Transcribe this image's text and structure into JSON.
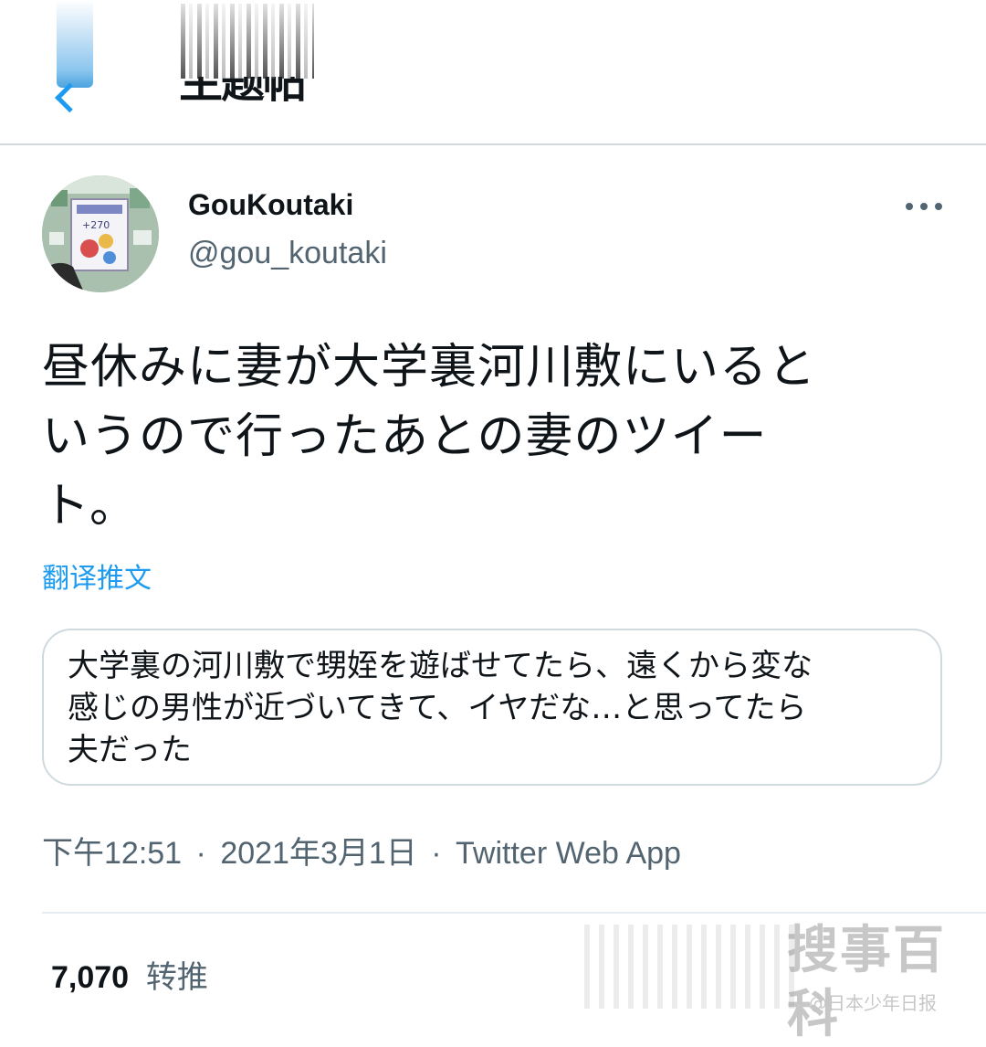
{
  "header": {
    "back_icon": "back-arrow-icon",
    "title": "主题帖"
  },
  "tweet": {
    "author_name": "GouKoutaki",
    "author_handle": "@gou_koutaki",
    "more_icon": "more-horizontal-icon",
    "text_lines": [
      "昼休みに妻が大学裏河川敷にいると",
      "いうので行ったあとの妻のツイー",
      "ト。"
    ],
    "translate_label": "翻译推文",
    "quote_lines": [
      "大学裏の河川敷で甥姪を遊ばせてたら、遠くから変な",
      "感じの男性が近づいてきて、イヤだな…と思ってたら",
      "夫だった"
    ],
    "time": "下午12:51",
    "date": "2021年3月1日",
    "separator": "·",
    "source": "Twitter Web App",
    "retweets_count": "7,070",
    "retweets_label": "转推"
  },
  "watermark": {
    "main": "搜事百科",
    "sub": "@日本少年日报"
  },
  "colors": {
    "accent": "#1d9bf0",
    "secondary_text": "#536471",
    "primary_text": "#0f1419",
    "border": "#cfd9de"
  }
}
